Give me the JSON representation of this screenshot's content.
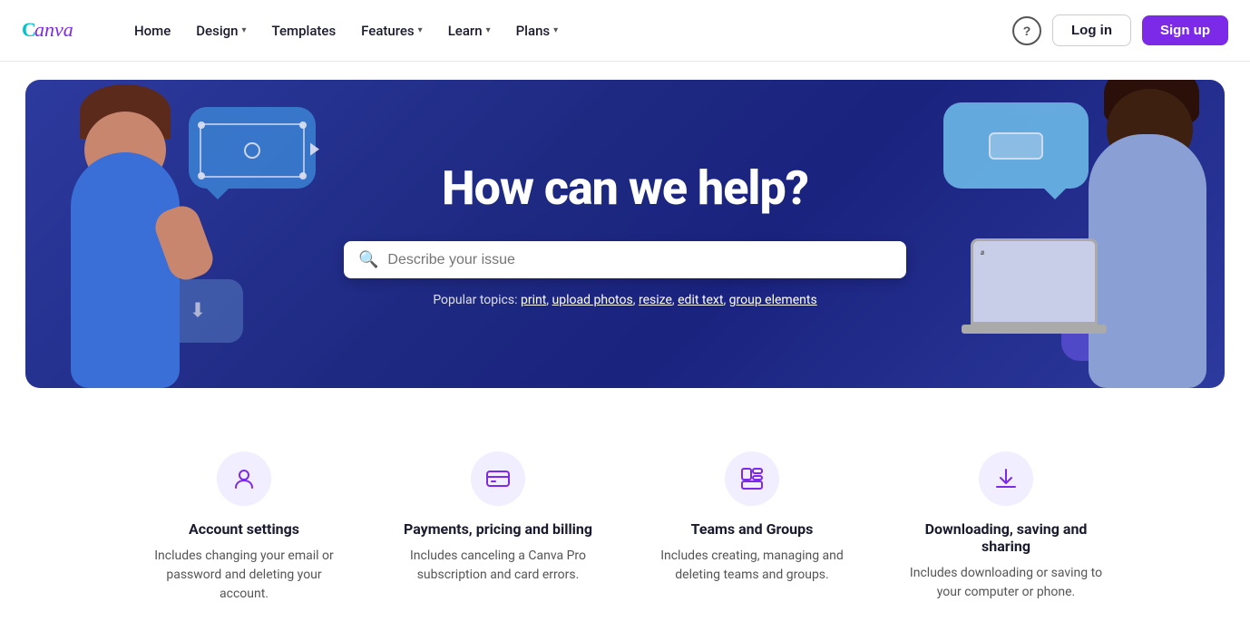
{
  "nav": {
    "logo_text": "Canva",
    "links": [
      {
        "label": "Home",
        "has_dropdown": false
      },
      {
        "label": "Design",
        "has_dropdown": true
      },
      {
        "label": "Templates",
        "has_dropdown": false
      },
      {
        "label": "Features",
        "has_dropdown": true
      },
      {
        "label": "Learn",
        "has_dropdown": true
      },
      {
        "label": "Plans",
        "has_dropdown": true
      }
    ],
    "login_label": "Log in",
    "signup_label": "Sign up",
    "help_label": "?"
  },
  "hero": {
    "title": "How can we help?",
    "search_placeholder": "Describe your issue",
    "popular_label": "Popular topics:",
    "popular_topics": [
      {
        "label": "print"
      },
      {
        "label": "upload photos"
      },
      {
        "label": "resize"
      },
      {
        "label": "edit text"
      },
      {
        "label": "group elements"
      }
    ]
  },
  "categories": [
    {
      "id": "account-settings",
      "icon": "👤",
      "title": "Account settings",
      "description": "Includes changing your email or password and deleting your account."
    },
    {
      "id": "payments-billing",
      "icon": "💳",
      "title": "Payments, pricing and billing",
      "description": "Includes canceling a Canva Pro subscription and card errors."
    },
    {
      "id": "teams-groups",
      "icon": "📊",
      "title": "Teams and Groups",
      "description": "Includes creating, managing and deleting teams and groups."
    },
    {
      "id": "downloading-sharing",
      "icon": "⬇️",
      "title": "Downloading, saving and sharing",
      "description": "Includes downloading or saving to your computer or phone."
    }
  ]
}
